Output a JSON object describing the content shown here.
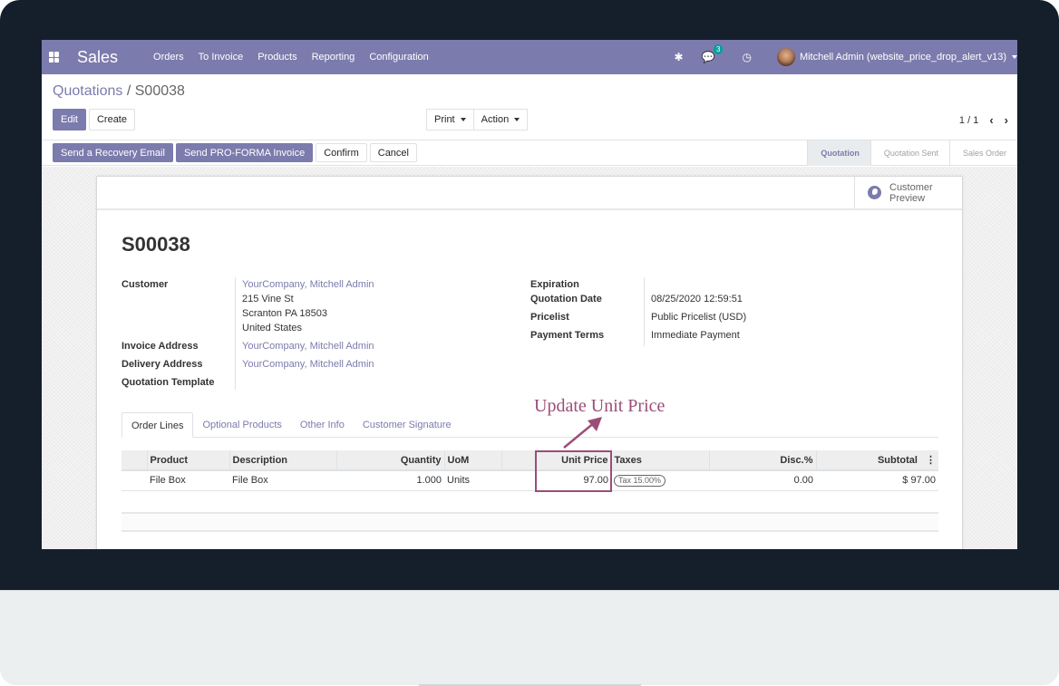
{
  "navbar": {
    "app_name": "Sales",
    "menu": [
      "Orders",
      "To Invoice",
      "Products",
      "Reporting",
      "Configuration"
    ],
    "icons": [
      "apps-grid-icon",
      "bug-icon",
      "chat-icon",
      "clock-icon"
    ],
    "messages_count": "3",
    "user_name": "Mitchell Admin (website_price_drop_alert_v13)"
  },
  "breadcrumb": {
    "parent": "Quotations",
    "separator": "/",
    "current": "S00038"
  },
  "control_panel": {
    "edit_label": "Edit",
    "create_label": "Create",
    "print_label": "Print",
    "action_label": "Action",
    "pager": "1 / 1",
    "prev_icon": "‹",
    "next_icon": "›"
  },
  "statusbar": {
    "buttons": [
      "Send a Recovery Email",
      "Send PRO-FORMA Invoice",
      "Confirm",
      "Cancel"
    ],
    "stages": [
      "Quotation",
      "Quotation Sent",
      "Sales Order"
    ],
    "active_stage": "Quotation"
  },
  "sheet": {
    "customer_preview_line1": "Customer",
    "customer_preview_line2": "Preview",
    "title": "S00038",
    "left_fields": {
      "customer_label": "Customer",
      "customer_name": "YourCompany, Mitchell Admin",
      "customer_street": "215 Vine St",
      "customer_city": "Scranton PA 18503",
      "customer_country": "United States",
      "invoice_label": "Invoice Address",
      "invoice_value": "YourCompany, Mitchell Admin",
      "delivery_label": "Delivery Address",
      "delivery_value": "YourCompany, Mitchell Admin",
      "template_label": "Quotation Template",
      "template_value": ""
    },
    "right_fields": {
      "expiration_label": "Expiration",
      "expiration_value": "",
      "date_label": "Quotation Date",
      "date_value": "08/25/2020 12:59:51",
      "pricelist_label": "Pricelist",
      "pricelist_value": "Public Pricelist (USD)",
      "terms_label": "Payment Terms",
      "terms_value": "Immediate Payment"
    },
    "tabs": [
      "Order Lines",
      "Optional Products",
      "Other Info",
      "Customer Signature"
    ],
    "active_tab": "Order Lines",
    "table": {
      "columns": [
        "",
        "Product",
        "Description",
        "Quantity",
        "UoM",
        "",
        "Unit Price",
        "Taxes",
        "Disc.%",
        "Subtotal"
      ],
      "rows": [
        {
          "product": "File Box",
          "description": "File Box",
          "quantity": "1.000",
          "uom": "Units",
          "unit_price": "97.00",
          "taxes": "Tax 15.00%",
          "discount": "0.00",
          "subtotal": "$ 97.00"
        }
      ]
    }
  },
  "annotation": {
    "text": "Update Unit Price",
    "color": "#9b4d78"
  },
  "colors": {
    "brand": "#7c7bad",
    "frame": "#141f2b"
  }
}
